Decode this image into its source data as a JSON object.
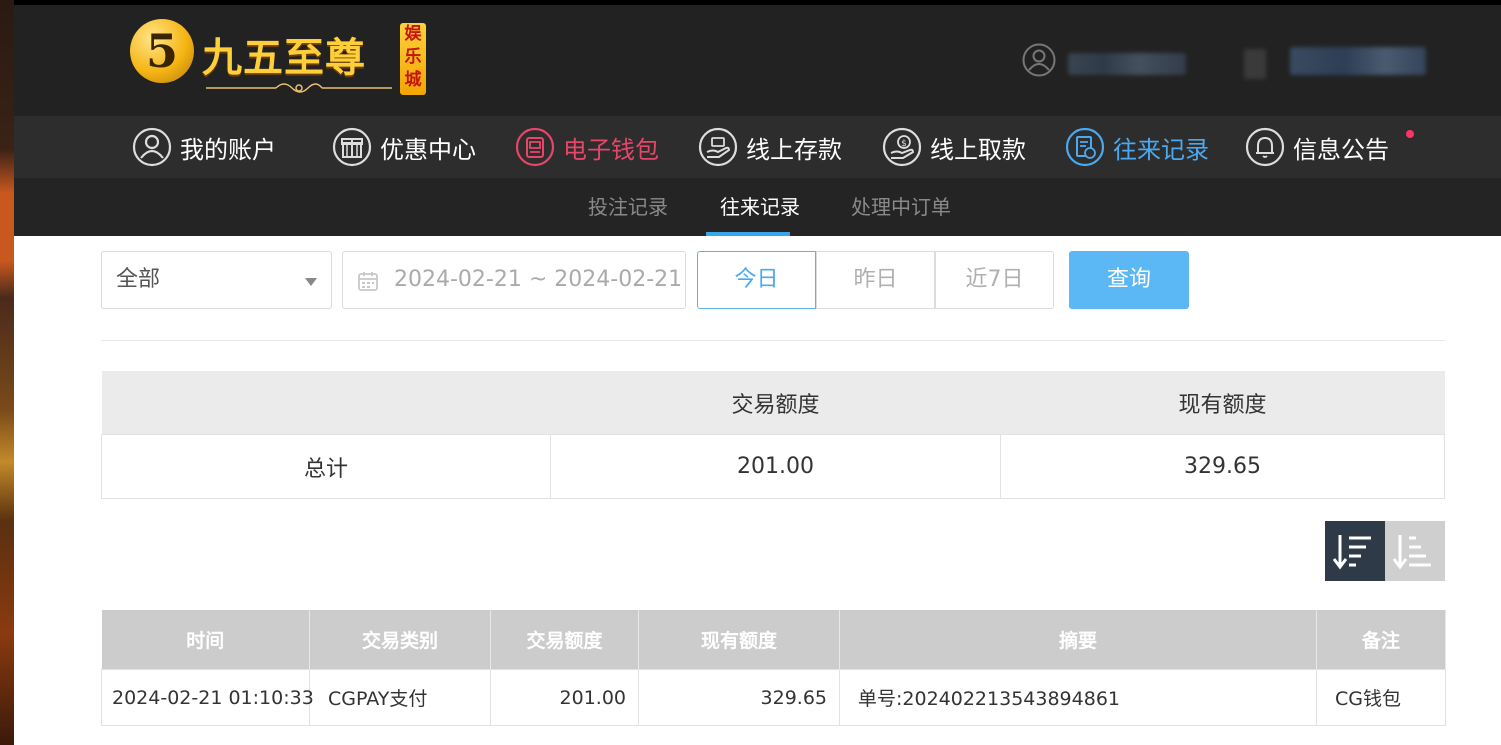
{
  "brand": {
    "mark": "5",
    "name": "九五至尊",
    "badge": "娱乐城"
  },
  "nav": {
    "items": [
      {
        "label": "我的账户",
        "icon": "user-icon",
        "state": "normal"
      },
      {
        "label": "优惠中心",
        "icon": "gift-icon",
        "state": "normal"
      },
      {
        "label": "电子钱包",
        "icon": "wallet-icon",
        "state": "highlight"
      },
      {
        "label": "线上存款",
        "icon": "deposit-icon",
        "state": "normal"
      },
      {
        "label": "线上取款",
        "icon": "withdraw-icon",
        "state": "normal"
      },
      {
        "label": "往来记录",
        "icon": "records-icon",
        "state": "active"
      },
      {
        "label": "信息公告",
        "icon": "bell-icon",
        "state": "normal",
        "dot": true
      }
    ]
  },
  "subnav": {
    "items": [
      {
        "label": "投注记录"
      },
      {
        "label": "往来记录",
        "active": true
      },
      {
        "label": "处理中订单"
      }
    ]
  },
  "filters": {
    "type_select": "全部",
    "date_range": "2024-02-21 ~ 2024-02-21",
    "quick": [
      "今日",
      "昨日",
      "近7日"
    ],
    "quick_active": "今日",
    "search": "查询"
  },
  "summary": {
    "headers": [
      "",
      "交易额度",
      "现有额度"
    ],
    "row": [
      "总计",
      "201.00",
      "329.65"
    ]
  },
  "detail": {
    "headers": [
      "时间",
      "交易类别",
      "交易额度",
      "现有额度",
      "摘要",
      "备注"
    ],
    "rows": [
      [
        "2024-02-21 01:10:33",
        "CGPAY支付",
        "201.00",
        "329.65",
        "单号:20240221354389486​1",
        "CG钱包"
      ]
    ]
  },
  "colors": {
    "header_bg": "#222222",
    "nav_bg": "#2d2d2d",
    "accent_blue": "#4aa9f0",
    "highlight_pink": "#e8456a",
    "search_button": "#5bb8f5"
  }
}
